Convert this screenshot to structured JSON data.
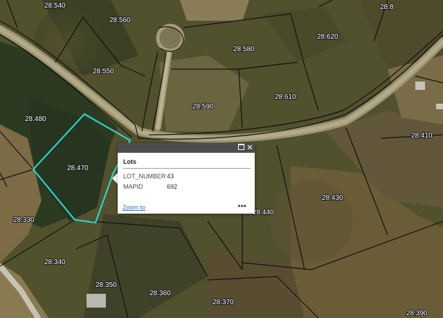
{
  "map": {
    "lot_labels": [
      {
        "id": "28.540",
        "text": "28.540"
      },
      {
        "id": "28.560",
        "text": "28.560"
      },
      {
        "id": "28.8",
        "text": "28.8"
      },
      {
        "id": "28.620",
        "text": "28.620"
      },
      {
        "id": "28.580",
        "text": "28.580"
      },
      {
        "id": "28.550",
        "text": "28.550"
      },
      {
        "id": "28.590",
        "text": "28.590"
      },
      {
        "id": "28.610",
        "text": "28.610"
      },
      {
        "id": "28.480",
        "text": "28.480"
      },
      {
        "id": "28.410",
        "text": "28.410"
      },
      {
        "id": "28.470",
        "text": "28.470"
      },
      {
        "id": "28.330",
        "text": "28.330"
      },
      {
        "id": "28.440",
        "text": "28.440"
      },
      {
        "id": "28.430",
        "text": "28.430"
      },
      {
        "id": "28.340",
        "text": "28.340"
      },
      {
        "id": "28.350",
        "text": "28.350"
      },
      {
        "id": "28.360",
        "text": "28.360"
      },
      {
        "id": "28.370",
        "text": "28.370"
      },
      {
        "id": "28.390",
        "text": "28.390"
      }
    ],
    "highlight_color": "#2ed3c8",
    "parcel_line_color": "#111111"
  },
  "popup": {
    "title": "Lots",
    "fields": [
      {
        "label": "LOT_NUMBER",
        "value": "43"
      },
      {
        "label": "MAPID",
        "value": "692"
      }
    ],
    "zoom_link": "Zoom to",
    "more_label": "•••",
    "close_label": "✕",
    "header_color": "#4c4c4c"
  }
}
